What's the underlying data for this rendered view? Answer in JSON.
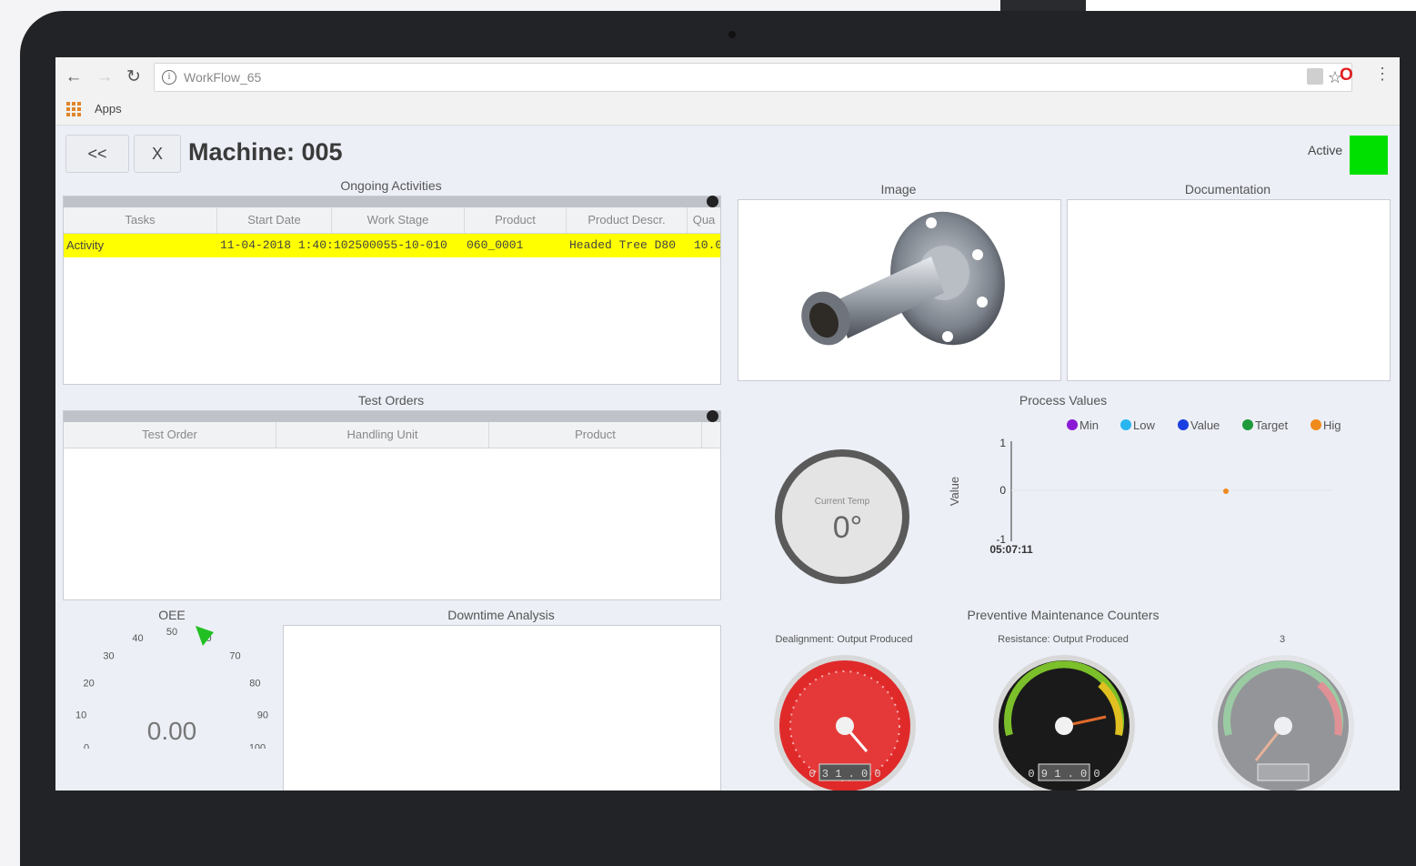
{
  "browser": {
    "url": "WorkFlow_65",
    "apps_label": "Apps"
  },
  "header": {
    "back_label": "<<",
    "close_label": "X",
    "title": "Machine: 005",
    "status_label": "Active",
    "status_color": "#00e000"
  },
  "ongoing": {
    "title": "Ongoing Activities",
    "columns": [
      "Tasks",
      "Start Date",
      "Work Stage",
      "Product",
      "Product Descr.",
      "Qua"
    ],
    "rows": [
      [
        "Activity",
        "11-04-2018 1:40:",
        "102500055-10-010",
        "060_0001",
        "Headed Tree  D80",
        "10.0"
      ]
    ]
  },
  "test_orders": {
    "title": "Test Orders",
    "columns": [
      "Test Order",
      "Handling Unit",
      "Product"
    ]
  },
  "image_panel": {
    "title": "Image"
  },
  "documentation_panel": {
    "title": "Documentation"
  },
  "process_values": {
    "title": "Process Values",
    "temp_label": "Current Temp",
    "temp_value": "0°",
    "legend": [
      {
        "name": "Min",
        "color": "#8a1ad6"
      },
      {
        "name": "Low",
        "color": "#29b6f0"
      },
      {
        "name": "Value",
        "color": "#1a3fe0"
      },
      {
        "name": "Target",
        "color": "#1e9a3a"
      },
      {
        "name": "Hig",
        "color": "#f08a1a"
      }
    ],
    "y_axis_label": "Value",
    "y_ticks": [
      "1",
      "0",
      "-1"
    ],
    "x_tick": "05:07:11"
  },
  "chart_data": {
    "type": "scatter",
    "title": "Process Values",
    "ylabel": "Value",
    "ylim": [
      -1,
      1
    ],
    "series": [
      {
        "name": "Hig",
        "x": [
          "05:07:11"
        ],
        "y": [
          0
        ]
      }
    ]
  },
  "oee": {
    "title": "OEE",
    "value": "0.00",
    "ticks": [
      "0",
      "10",
      "20",
      "30",
      "40",
      "50",
      "60",
      "70",
      "80",
      "90",
      "100"
    ]
  },
  "downtime": {
    "title": "Downtime Analysis"
  },
  "maintenance": {
    "title": "Preventive Maintenance Counters",
    "gauges": [
      {
        "label": "Dealignment: Output Produced",
        "odometer": "0 3 1 . 0 0"
      },
      {
        "label": "Resistance: Output Produced",
        "odometer": "0 9 1 . 0 0"
      },
      {
        "label": "3",
        "odometer": ""
      }
    ]
  }
}
